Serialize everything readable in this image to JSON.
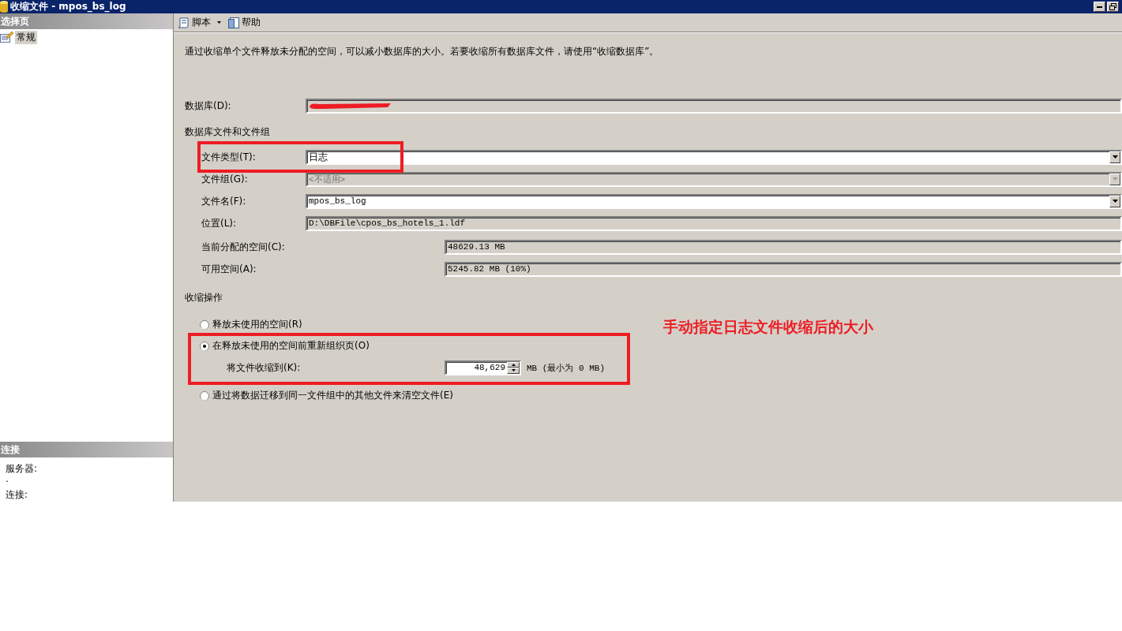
{
  "window": {
    "title": "收缩文件 - mpos_bs_log"
  },
  "sidebar": {
    "header": "选择页",
    "pages": [
      {
        "label": "常规",
        "selected": true
      }
    ],
    "connection": {
      "header": "连接",
      "items": [
        {
          "label": "服务器:",
          "value": "."
        },
        {
          "label": "连接:"
        }
      ]
    }
  },
  "toolbar": [
    {
      "kind": "dropdown",
      "label": "脚本"
    },
    {
      "kind": "button",
      "label": "帮助"
    }
  ],
  "description": "通过收缩单个文件释放未分配的空间，可以减小数据库的大小。若要收缩所有数据库文件，请使用“收缩数据库”。",
  "database": {
    "label": "数据库(D):"
  },
  "files": {
    "title": "数据库文件和文件组",
    "fields": [
      {
        "label": "文件类型(T):",
        "value": "日志",
        "kind": "dropdown",
        "disabled": false
      },
      {
        "label": "文件组(G):",
        "value": "<不适用>",
        "kind": "dropdown",
        "disabled": true
      },
      {
        "label": "文件名(F):",
        "value": "mpos_bs_log",
        "kind": "dropdown",
        "disabled": false
      },
      {
        "label": "位置(L):",
        "value": "D:\\DBFile\\cpos_bs_hotels_1.ldf",
        "kind": "readonly",
        "disabled": false
      },
      {
        "label": "当前分配的空间(C):",
        "value": "48629.13 MB",
        "kind": "size",
        "disabled": false
      },
      {
        "label": "可用空间(A):",
        "value": "5245.82 MB (10%)",
        "kind": "size",
        "disabled": false
      }
    ]
  },
  "shrink": {
    "title": "收缩操作",
    "options": [
      {
        "label": "释放未使用的空间(R)",
        "selected": false
      },
      {
        "label": "在释放未使用的空间前重新组织页(O)",
        "selected": true,
        "target": {
          "label": "将文件收缩到(K):",
          "value": "48,629",
          "unit": "MB (最小为 0 MB)"
        }
      },
      {
        "label": "通过将数据迁移到同一文件组中的其他文件来清空文件(E)",
        "selected": false
      }
    ]
  },
  "annotation": {
    "text": "手动指定日志文件收缩后的大小"
  }
}
